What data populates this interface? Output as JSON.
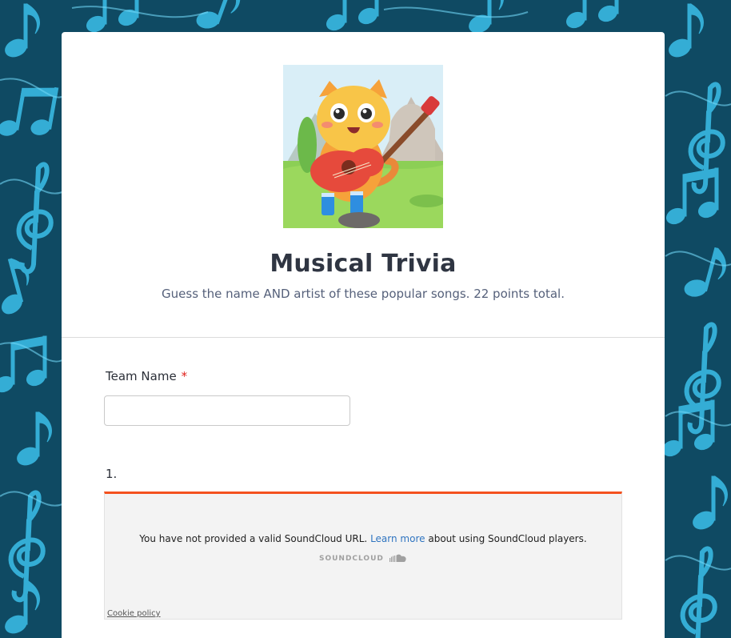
{
  "form": {
    "title": "Musical Trivia",
    "description": "Guess the name AND artist of these popular songs. 22 points total."
  },
  "team_field": {
    "label": "Team Name",
    "required_mark": "*",
    "value": ""
  },
  "question_1": {
    "number": "1."
  },
  "soundcloud": {
    "message_before": "You have not provided a valid SoundCloud URL.",
    "link_text": "Learn more",
    "message_after": "about using SoundCloud players.",
    "brand": "SOUNDCLOUD",
    "cookie_link": "Cookie policy"
  },
  "colors": {
    "accent_orange": "#f4511e",
    "required_red": "#e0201b",
    "link_blue": "#2f74c0",
    "background_dark": "#0f4a63",
    "note_cyan": "#3cc0ea"
  },
  "icons": [
    "cat-guitar-logo",
    "soundcloud-logo-icon",
    "music-notes-background"
  ]
}
